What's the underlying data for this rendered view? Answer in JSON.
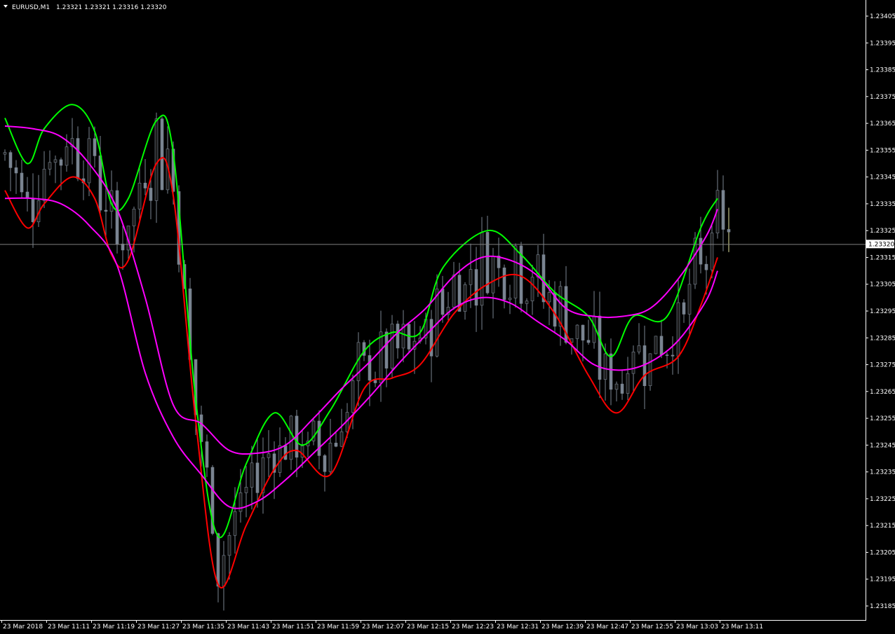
{
  "header": {
    "symbol_label": "EURUSD,M1",
    "ohlc": "1.23321 1.23321 1.23316 1.23320"
  },
  "colors": {
    "background": "#000000",
    "axis": "#ffffff",
    "candle_bull": "#1c1c1c",
    "candle_bear": "#7a8491",
    "candle_wick": "#7a8491",
    "green_line": "#00ff00",
    "red_line": "#ff0000",
    "magenta_line": "#ff00ff",
    "price_line": "#808080",
    "last_candle": "#e6e6a0"
  },
  "chart_data": {
    "type": "line",
    "title": "EURUSD,M1",
    "grid": false,
    "legend": "none",
    "ylim": [
      1.23178,
      1.23409
    ],
    "current_price": "1.23320",
    "y_ticks": [
      "1.23405",
      "1.23395",
      "1.23385",
      "1.23375",
      "1.23365",
      "1.23355",
      "1.23345",
      "1.23335",
      "1.23325",
      "1.23315",
      "1.23305",
      "1.23295",
      "1.23285",
      "1.23275",
      "1.23265",
      "1.23255",
      "1.23245",
      "1.23235",
      "1.23225",
      "1.23215",
      "1.23205",
      "1.23195",
      "1.23185"
    ],
    "x_ticks": [
      "23 Mar 2018",
      "23 Mar 11:11",
      "23 Mar 11:19",
      "23 Mar 11:27",
      "23 Mar 11:35",
      "23 Mar 11:43",
      "23 Mar 11:51",
      "23 Mar 11:59",
      "23 Mar 12:07",
      "23 Mar 12:15",
      "23 Mar 12:23",
      "23 Mar 12:31",
      "23 Mar 12:39",
      "23 Mar 12:47",
      "23 Mar 12:55",
      "23 Mar 13:03",
      "23 Mar 13:11"
    ],
    "candle_minutes": 130,
    "series": [
      {
        "color": "#00ff00",
        "points": [
          [
            0,
            1.23367
          ],
          [
            4,
            1.2335
          ],
          [
            7,
            1.23363
          ],
          [
            12,
            1.23372
          ],
          [
            16,
            1.23362
          ],
          [
            19,
            1.23335
          ],
          [
            22,
            1.23337
          ],
          [
            27,
            1.23366
          ],
          [
            30,
            1.23354
          ],
          [
            34,
            1.23262
          ],
          [
            38,
            1.23211
          ],
          [
            43,
            1.23238
          ],
          [
            48,
            1.23257
          ],
          [
            53,
            1.23245
          ],
          [
            58,
            1.23258
          ],
          [
            64,
            1.2328
          ],
          [
            69,
            1.23287
          ],
          [
            74,
            1.23287
          ],
          [
            78,
            1.23311
          ],
          [
            86,
            1.23325
          ],
          [
            92,
            1.23316
          ],
          [
            98,
            1.23302
          ],
          [
            104,
            1.23293
          ],
          [
            108,
            1.23278
          ],
          [
            112,
            1.23293
          ],
          [
            118,
            1.23293
          ],
          [
            124,
            1.23326
          ],
          [
            127,
            1.23337
          ]
        ]
      },
      {
        "color": "#ff0000",
        "points": [
          [
            0,
            1.2334
          ],
          [
            4,
            1.23326
          ],
          [
            7,
            1.23335
          ],
          [
            12,
            1.23345
          ],
          [
            16,
            1.23337
          ],
          [
            19,
            1.23316
          ],
          [
            22,
            1.23314
          ],
          [
            27,
            1.2335
          ],
          [
            30,
            1.23338
          ],
          [
            34,
            1.23254
          ],
          [
            38,
            1.23193
          ],
          [
            43,
            1.23215
          ],
          [
            48,
            1.23236
          ],
          [
            52,
            1.23243
          ],
          [
            58,
            1.23234
          ],
          [
            64,
            1.23266
          ],
          [
            69,
            1.2327
          ],
          [
            74,
            1.23275
          ],
          [
            80,
            1.23294
          ],
          [
            86,
            1.23305
          ],
          [
            92,
            1.23308
          ],
          [
            98,
            1.23294
          ],
          [
            104,
            1.23271
          ],
          [
            109,
            1.23257
          ],
          [
            114,
            1.23271
          ],
          [
            120,
            1.23278
          ],
          [
            124,
            1.23297
          ],
          [
            127,
            1.23315
          ]
        ]
      },
      {
        "color": "#ff00ff",
        "points": [
          [
            0,
            1.23364
          ],
          [
            5,
            1.23363
          ],
          [
            10,
            1.2336
          ],
          [
            15,
            1.2335
          ],
          [
            20,
            1.23333
          ],
          [
            25,
            1.233
          ],
          [
            30,
            1.2326
          ],
          [
            35,
            1.23253
          ],
          [
            40,
            1.23243
          ],
          [
            45,
            1.23242
          ],
          [
            50,
            1.23245
          ],
          [
            55,
            1.23255
          ],
          [
            60,
            1.23266
          ],
          [
            65,
            1.23276
          ],
          [
            70,
            1.23287
          ],
          [
            75,
            1.23296
          ],
          [
            80,
            1.23308
          ],
          [
            85,
            1.23315
          ],
          [
            90,
            1.23314
          ],
          [
            95,
            1.23308
          ],
          [
            100,
            1.23296
          ],
          [
            105,
            1.23293
          ],
          [
            110,
            1.23293
          ],
          [
            115,
            1.23296
          ],
          [
            120,
            1.23307
          ],
          [
            125,
            1.23323
          ],
          [
            127,
            1.23333
          ]
        ]
      },
      {
        "color": "#ff00ff",
        "points": [
          [
            0,
            1.23337
          ],
          [
            5,
            1.23337
          ],
          [
            10,
            1.23335
          ],
          [
            15,
            1.23327
          ],
          [
            20,
            1.23312
          ],
          [
            25,
            1.23272
          ],
          [
            30,
            1.23248
          ],
          [
            35,
            1.23234
          ],
          [
            40,
            1.23222
          ],
          [
            45,
            1.23224
          ],
          [
            50,
            1.23232
          ],
          [
            55,
            1.23242
          ],
          [
            60,
            1.23252
          ],
          [
            65,
            1.23263
          ],
          [
            70,
            1.23275
          ],
          [
            75,
            1.23286
          ],
          [
            80,
            1.23296
          ],
          [
            85,
            1.233
          ],
          [
            90,
            1.23298
          ],
          [
            95,
            1.23291
          ],
          [
            100,
            1.23284
          ],
          [
            105,
            1.23275
          ],
          [
            110,
            1.23273
          ],
          [
            115,
            1.23276
          ],
          [
            120,
            1.23284
          ],
          [
            125,
            1.23299
          ],
          [
            127,
            1.2331
          ]
        ]
      }
    ]
  }
}
